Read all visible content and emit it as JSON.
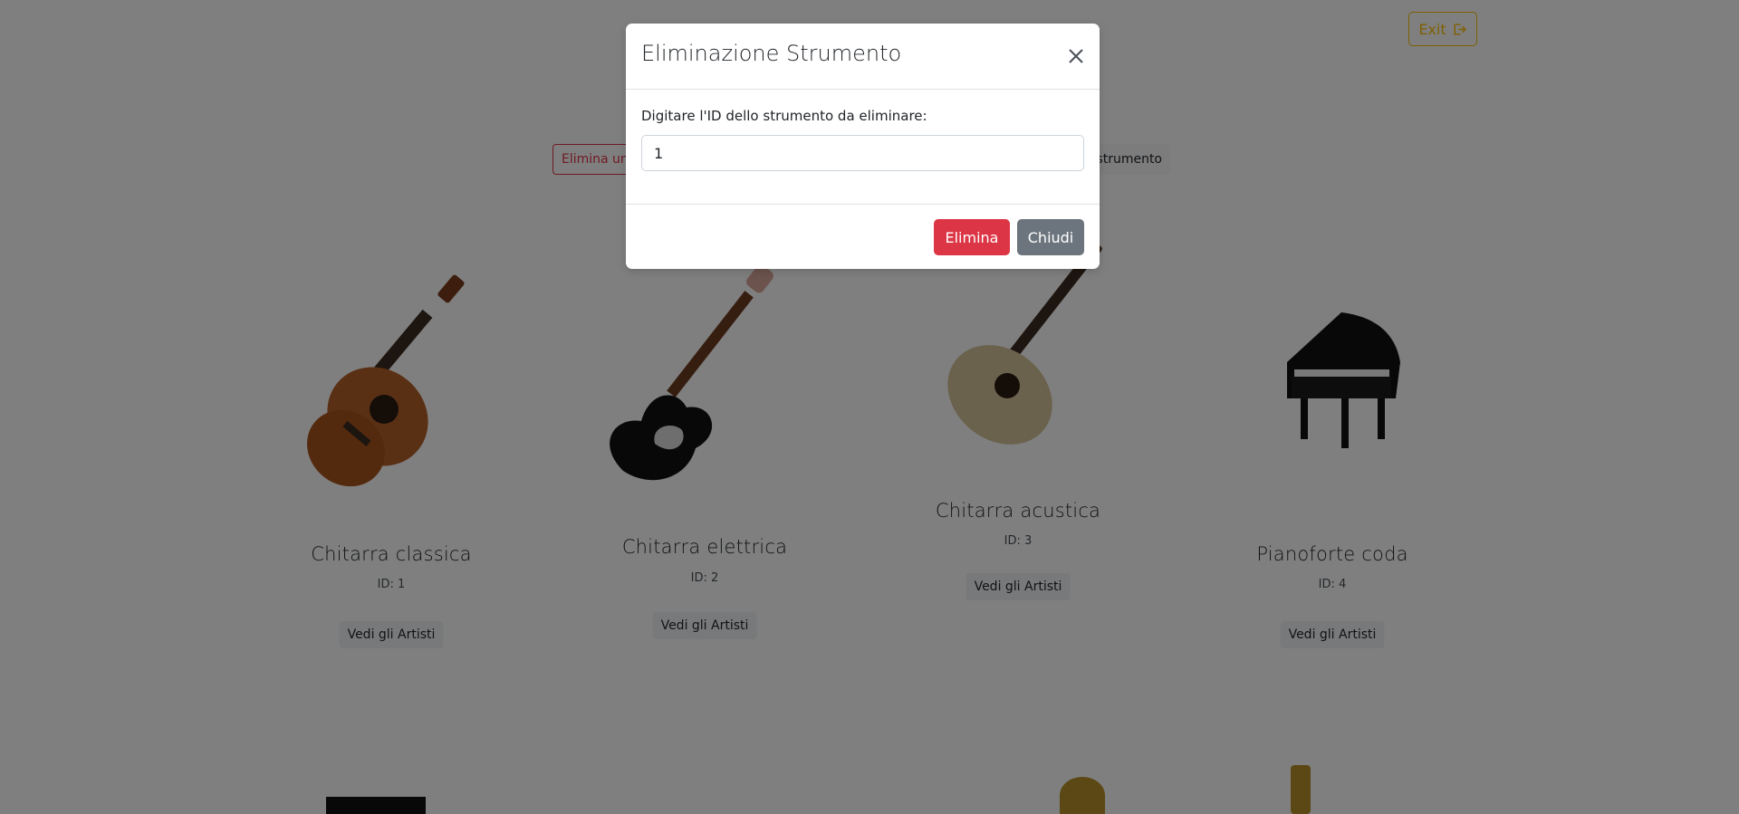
{
  "header": {
    "exit_label": "Exit",
    "delete_instrument_label": "Elimina uno strumento",
    "add_instrument_label": "strumento"
  },
  "instruments": [
    {
      "name": "Chitarra classica",
      "id_label": "ID: 1",
      "artists_label": "Vedi gli Artisti"
    },
    {
      "name": "Chitarra elettrica",
      "id_label": "ID: 2",
      "artists_label": "Vedi gli Artisti"
    },
    {
      "name": "Chitarra acustica",
      "id_label": "ID: 3",
      "artists_label": "Vedi gli Artisti"
    },
    {
      "name": "Pianoforte coda",
      "id_label": "ID: 4",
      "artists_label": "Vedi gli Artisti"
    }
  ],
  "modal": {
    "title": "Eliminazione Strumento",
    "label": "Digitare l'ID dello strumento da eliminare:",
    "input_value": "1",
    "delete_button": "Elimina",
    "close_button": "Chiudi"
  },
  "colors": {
    "warning": "#ffc107",
    "danger": "#dc3545",
    "secondary": "#6c757d"
  }
}
